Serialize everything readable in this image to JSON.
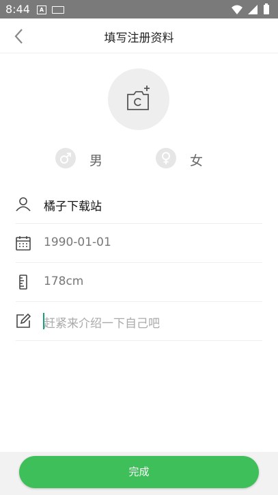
{
  "status_bar": {
    "time": "8:44",
    "a_badge": "A"
  },
  "header": {
    "title": "填写注册资料"
  },
  "gender": {
    "male_label": "男",
    "female_label": "女"
  },
  "form": {
    "nickname": "橘子下载站",
    "birthday": "1990-01-01",
    "height": "178cm",
    "intro_placeholder": "赶紧来介绍一下自己吧"
  },
  "footer": {
    "done_label": "完成"
  },
  "colors": {
    "accent": "#3fbf5a",
    "status_bar": "#7a7a7a"
  }
}
